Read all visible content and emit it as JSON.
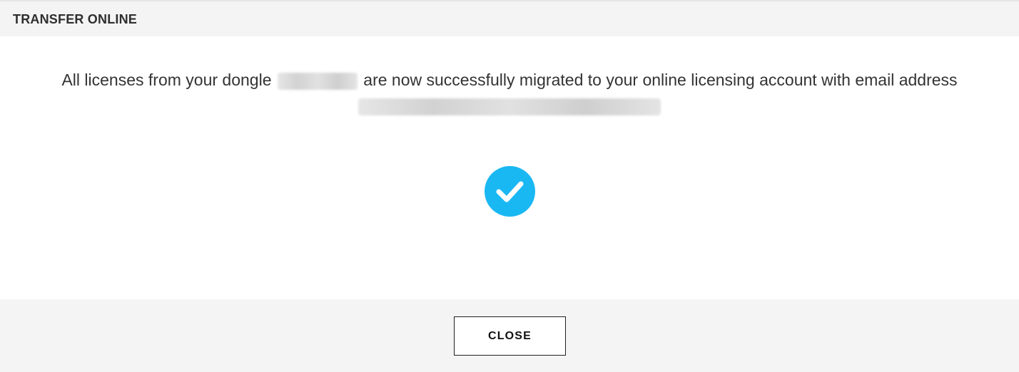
{
  "header": {
    "title": "TRANSFER ONLINE"
  },
  "message": {
    "part1": "All licenses from your dongle",
    "part2": "are now successfully migrated to your online licensing account with email address"
  },
  "icons": {
    "success": "check-circle-icon"
  },
  "colors": {
    "accent": "#1ab8f3",
    "header_bg": "#f4f4f4",
    "footer_bg": "#f4f4f4"
  },
  "footer": {
    "close_label": "CLOSE"
  }
}
